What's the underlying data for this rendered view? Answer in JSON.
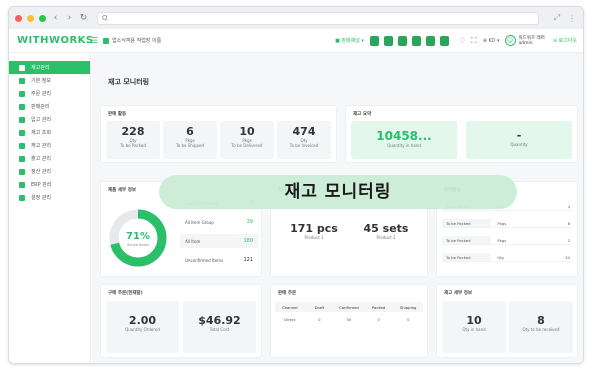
{
  "browser": {
    "address_text": "Q",
    "nav_back": "‹",
    "nav_forward": "›",
    "reload": "↻",
    "expand": "⤢",
    "more": "⋮"
  },
  "header": {
    "logo": "WITHWORKS",
    "breadcrumb": "업소식객용 작업장 이름",
    "store_selector": "■ 판매채널 ▾",
    "lang": "⊕ KO ▾",
    "user_name": "워드위즈 래퍼",
    "user_role": "admin",
    "logout": "⊖ 로그아웃"
  },
  "sidebar": {
    "items": [
      {
        "label": "재고관리",
        "active": true
      },
      {
        "label": "기본 정보",
        "active": false
      },
      {
        "label": "주문 관리",
        "active": false
      },
      {
        "label": "판매관리",
        "active": false
      },
      {
        "label": "입고 관리",
        "active": false
      },
      {
        "label": "재고 조회",
        "active": false
      },
      {
        "label": "재고 관리",
        "active": false
      },
      {
        "label": "출고 관리",
        "active": false
      },
      {
        "label": "정산 관리",
        "active": false
      },
      {
        "label": "ERP 관리",
        "active": false
      },
      {
        "label": "설정 관리",
        "active": false
      }
    ]
  },
  "page": {
    "title": "재고 모니터링"
  },
  "sales_activity": {
    "title": "판매 활동",
    "stats": [
      {
        "value": "228",
        "unit": "Qty",
        "label": "To be Packed"
      },
      {
        "value": "6",
        "unit": "Pkgs",
        "label": "To be Shipped"
      },
      {
        "value": "10",
        "unit": "Pkgs",
        "label": "To be Delivered"
      },
      {
        "value": "474",
        "unit": "Qty",
        "label": "To be Invoiced"
      }
    ]
  },
  "inventory_summary": {
    "title": "재고 요약",
    "qty_value": "10458...",
    "qty_label": "Quantity in hand",
    "second_value": "-",
    "second_label": "Quantity"
  },
  "product_details": {
    "title": "제품 세부 정보",
    "percent": "71%",
    "percent_label": "Active Items",
    "percent_value": 0.71,
    "rows": [
      {
        "label": "Low Stock Items",
        "value": "0"
      },
      {
        "label": "All Item Group",
        "value": "39"
      },
      {
        "label": "All Item",
        "value": "180"
      },
      {
        "label": "Unconfirmed Items",
        "value": "121"
      }
    ]
  },
  "top_selling": {
    "title": "최다 판매 상품",
    "items": [
      {
        "value": "171 pcs",
        "label": "Product 1"
      },
      {
        "value": "45 sets",
        "label": "Product 2"
      }
    ]
  },
  "activity": {
    "title": "판매활동",
    "rows": [
      {
        "status": "To be Packed",
        "unit": "Qty",
        "value": "4"
      },
      {
        "status": "To be Packed",
        "unit": "Pkgs",
        "value": "6"
      },
      {
        "status": "To be Packed",
        "unit": "Pkgs",
        "value": "2"
      },
      {
        "status": "To be Packed",
        "unit": "Qty",
        "value": "34"
      }
    ]
  },
  "purchase_order": {
    "title": "구매 주문(현재달)",
    "items": [
      {
        "value": "2.00",
        "label": "Quantity Ordered"
      },
      {
        "value": "$46.92",
        "label": "Total Cost"
      }
    ]
  },
  "sales_order": {
    "title": "판매 주문",
    "headers": [
      "Channel",
      "Draft",
      "Confirmed",
      "Packed",
      "Shipping"
    ],
    "rows": [
      [
        "Direct",
        "0",
        "50",
        "0",
        "0"
      ]
    ]
  },
  "inventory_detail": {
    "title": "재고 세부 정보",
    "items": [
      {
        "value": "10",
        "label": "Qty in hand"
      },
      {
        "value": "8",
        "label": "Qty to be received"
      }
    ]
  },
  "overlay": {
    "text": "재고 모니터링"
  },
  "colors": {
    "accent": "#2bbf6a",
    "overlay_bg": "#caecd6",
    "dot_red": "#ff5f57",
    "dot_yellow": "#febc2e",
    "dot_green": "#28c840"
  }
}
